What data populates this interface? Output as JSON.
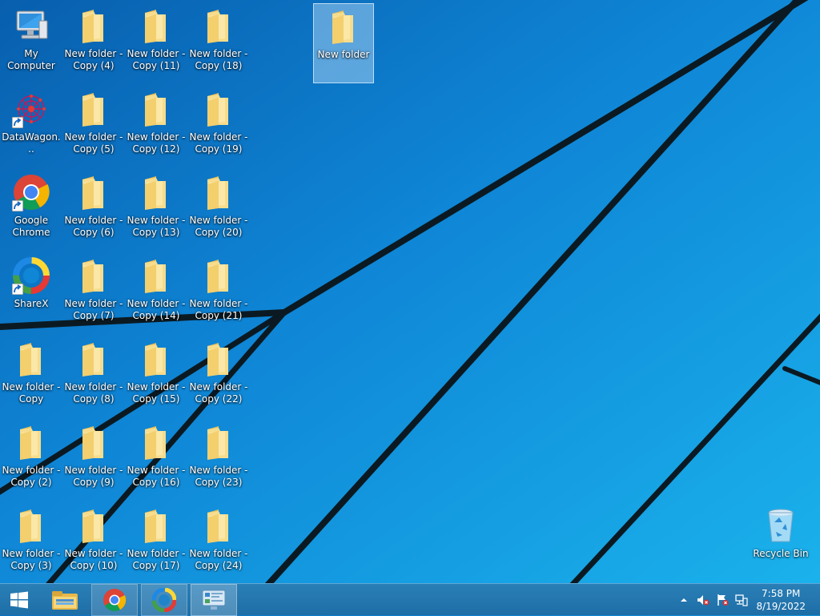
{
  "desktop": {
    "icons": [
      {
        "id": "my-computer",
        "label": "My Computer",
        "kind": "computer"
      },
      {
        "id": "datawagon",
        "label": "DataWagon...",
        "kind": "app-shortcut"
      },
      {
        "id": "chrome",
        "label": "Google Chrome",
        "kind": "chrome-shortcut"
      },
      {
        "id": "sharex",
        "label": "ShareX",
        "kind": "sharex-shortcut"
      },
      {
        "id": "nf",
        "label": "New folder - Copy",
        "kind": "folder"
      },
      {
        "id": "nf2",
        "label": "New folder - Copy (2)",
        "kind": "folder"
      },
      {
        "id": "nf3",
        "label": "New folder - Copy (3)",
        "kind": "folder"
      },
      {
        "id": "nf4",
        "label": "New folder - Copy (4)",
        "kind": "folder"
      },
      {
        "id": "nf5",
        "label": "New folder - Copy (5)",
        "kind": "folder"
      },
      {
        "id": "nf6",
        "label": "New folder - Copy (6)",
        "kind": "folder"
      },
      {
        "id": "nf7",
        "label": "New folder - Copy (7)",
        "kind": "folder"
      },
      {
        "id": "nf8",
        "label": "New folder - Copy (8)",
        "kind": "folder"
      },
      {
        "id": "nf9",
        "label": "New folder - Copy (9)",
        "kind": "folder"
      },
      {
        "id": "nf10",
        "label": "New folder - Copy (10)",
        "kind": "folder"
      },
      {
        "id": "nf11",
        "label": "New folder - Copy (11)",
        "kind": "folder"
      },
      {
        "id": "nf12",
        "label": "New folder - Copy (12)",
        "kind": "folder"
      },
      {
        "id": "nf13",
        "label": "New folder - Copy (13)",
        "kind": "folder"
      },
      {
        "id": "nf14",
        "label": "New folder - Copy (14)",
        "kind": "folder"
      },
      {
        "id": "nf15",
        "label": "New folder - Copy (15)",
        "kind": "folder"
      },
      {
        "id": "nf16",
        "label": "New folder - Copy (16)",
        "kind": "folder"
      },
      {
        "id": "nf17",
        "label": "New folder - Copy (17)",
        "kind": "folder"
      },
      {
        "id": "nf18",
        "label": "New folder - Copy (18)",
        "kind": "folder"
      },
      {
        "id": "nf19",
        "label": "New folder - Copy (19)",
        "kind": "folder"
      },
      {
        "id": "nf20",
        "label": "New folder - Copy (20)",
        "kind": "folder"
      },
      {
        "id": "nf21",
        "label": "New folder - Copy (21)",
        "kind": "folder"
      },
      {
        "id": "nf22",
        "label": "New folder - Copy (22)",
        "kind": "folder"
      },
      {
        "id": "nf23",
        "label": "New folder - Copy (23)",
        "kind": "folder"
      },
      {
        "id": "nf24",
        "label": "New folder - Copy (24)",
        "kind": "folder"
      },
      {
        "id": "new-folder",
        "label": "New folder",
        "kind": "folder",
        "selected": true
      },
      {
        "id": "recycle-bin",
        "label": "Recycle Bin",
        "kind": "recycle-bin"
      }
    ]
  },
  "taskbar": {
    "start_icon": "windows-logo-icon",
    "pinned": [
      {
        "id": "explorer",
        "icon": "file-explorer-icon"
      },
      {
        "id": "chrome",
        "icon": "chrome-icon"
      },
      {
        "id": "sharex",
        "icon": "sharex-icon"
      },
      {
        "id": "control-panel",
        "icon": "control-panel-icon"
      }
    ],
    "tray": {
      "icons": [
        "show-hidden-icons-chevron-icon",
        "volume-muted-icon",
        "action-center-flag-icon",
        "network-icon"
      ],
      "time": "7:58 PM",
      "date": "8/19/2022"
    }
  },
  "colors": {
    "wallpaper_dark": "#0a72c6",
    "wallpaper_light": "#1aaeea",
    "taskbar": "#1e6ea6",
    "folder": "#f3d57e"
  }
}
